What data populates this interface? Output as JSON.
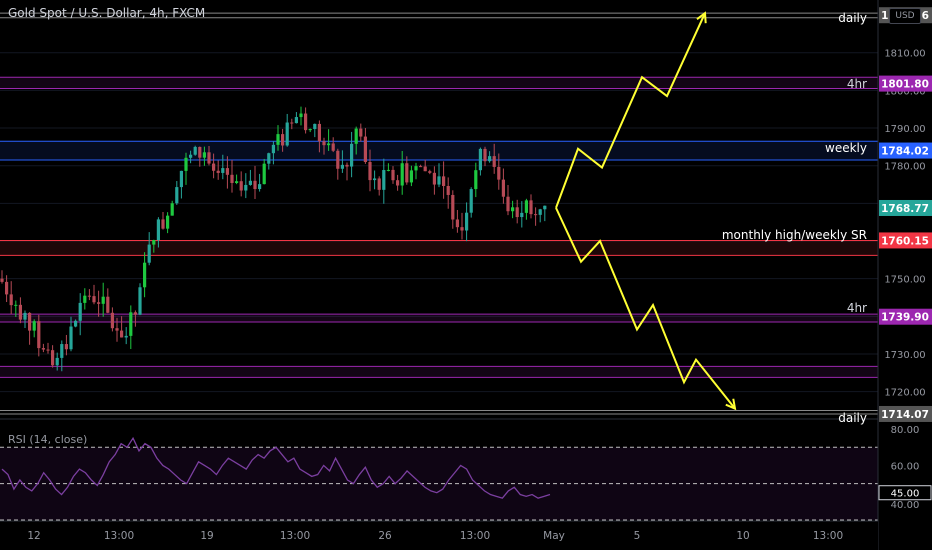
{
  "header": {
    "symbol": "Gold Spot / U.S. Dollar, 4h, FXCM",
    "currency": "USD"
  },
  "rsi": {
    "title": "RSI (14, close)",
    "ticks": [
      "80.00",
      "60.00",
      "45.00",
      "40.00"
    ]
  },
  "annotations": {
    "daily_top": "daily",
    "hr4_top": "4hr",
    "weekly": "weekly",
    "monthly": "monthly high/weekly SR",
    "hr4_bottom": "4hr",
    "daily_bottom": "daily"
  },
  "colors": {
    "background": "#000000",
    "up": "#26a69a",
    "up_bright": "#1ec940",
    "down": "#b74a56",
    "yellow": "#ffff33",
    "purple": "#9c27b0",
    "blue": "#2962ff",
    "red": "#f23645",
    "rsi_line": "#7b3fa0"
  },
  "chart_data": {
    "type": "candlestick",
    "ylim": [
      1713,
      1824
    ],
    "y_ticks": [
      1720,
      1730,
      1740,
      1750,
      1760,
      1770,
      1780,
      1790,
      1800,
      1810
    ],
    "x_ticks": [
      "12",
      "13:00",
      "19",
      "13:00",
      "26",
      "13:00",
      "May",
      "5",
      "10",
      "13:00"
    ],
    "price_labels": [
      {
        "text": "1819.96",
        "value": 1819.96,
        "color": "#555555"
      },
      {
        "text": "1801.80",
        "value": 1801.8,
        "color": "#9c27b0"
      },
      {
        "text": "1784.02",
        "value": 1784.02,
        "color": "#2962ff"
      },
      {
        "text": "1768.77",
        "value": 1768.77,
        "color": "#26a69a"
      },
      {
        "text": "1760.15",
        "value": 1760.15,
        "color": "#f23645"
      },
      {
        "text": "1739.90",
        "value": 1739.9,
        "color": "#9c27b0"
      },
      {
        "text": "1714.07",
        "value": 1714.07,
        "color": "#555555"
      }
    ],
    "levels": [
      {
        "name": "daily-top",
        "values": [
          1819.3,
          1820.5
        ],
        "color": "#888888",
        "style": "double"
      },
      {
        "name": "4hr-top",
        "values": [
          1800.5,
          1803.5
        ],
        "color": "#9c27b0",
        "style": "band"
      },
      {
        "name": "weekly",
        "values": [
          1781.5,
          1786.5
        ],
        "color": "#2962ff",
        "style": "band"
      },
      {
        "name": "monthly",
        "values": [
          1756.2,
          1760.15
        ],
        "color": "#f23645",
        "style": "band"
      },
      {
        "name": "4hr-bottom",
        "values": [
          1738.5,
          1740.6
        ],
        "color": "#9c27b0",
        "style": "band"
      },
      {
        "name": "4hr-lower",
        "values": [
          1723.8,
          1726.7
        ],
        "color": "#9c27b0",
        "style": "band"
      },
      {
        "name": "daily-bottom",
        "values": [
          1714.07,
          1715.0
        ],
        "color": "#888888",
        "style": "double"
      }
    ],
    "path_up": [
      [
        1768.8,
        0
      ],
      [
        1784.5,
        1
      ],
      [
        1779.5,
        2
      ],
      [
        1803.5,
        3
      ],
      [
        1798.5,
        4
      ],
      [
        1820.5,
        5
      ]
    ],
    "path_down": [
      [
        1768.8,
        0
      ],
      [
        1754.5,
        1
      ],
      [
        1760.0,
        2
      ],
      [
        1736.5,
        3
      ],
      [
        1743.0,
        4
      ],
      [
        1722.5,
        5
      ],
      [
        1728.5,
        6
      ],
      [
        1715.5,
        7
      ]
    ],
    "rsi_values": [
      58,
      55,
      47,
      52,
      48,
      46,
      50,
      56,
      52,
      47,
      44,
      48,
      54,
      58,
      56,
      52,
      49,
      55,
      62,
      66,
      72,
      70,
      75,
      68,
      72,
      70,
      64,
      60,
      58,
      55,
      52,
      50,
      56,
      62,
      60,
      58,
      55,
      60,
      64,
      62,
      60,
      58,
      63,
      66,
      64,
      68,
      70,
      66,
      62,
      64,
      58,
      56,
      54,
      55,
      60,
      57,
      64,
      58,
      52,
      50,
      55,
      59,
      52,
      48,
      50,
      54,
      50,
      53,
      57,
      54,
      51,
      48,
      46,
      45,
      47,
      52,
      56,
      60,
      58,
      52,
      49,
      46,
      44,
      43,
      42,
      46,
      48,
      44,
      43,
      44,
      42,
      43,
      44
    ]
  }
}
